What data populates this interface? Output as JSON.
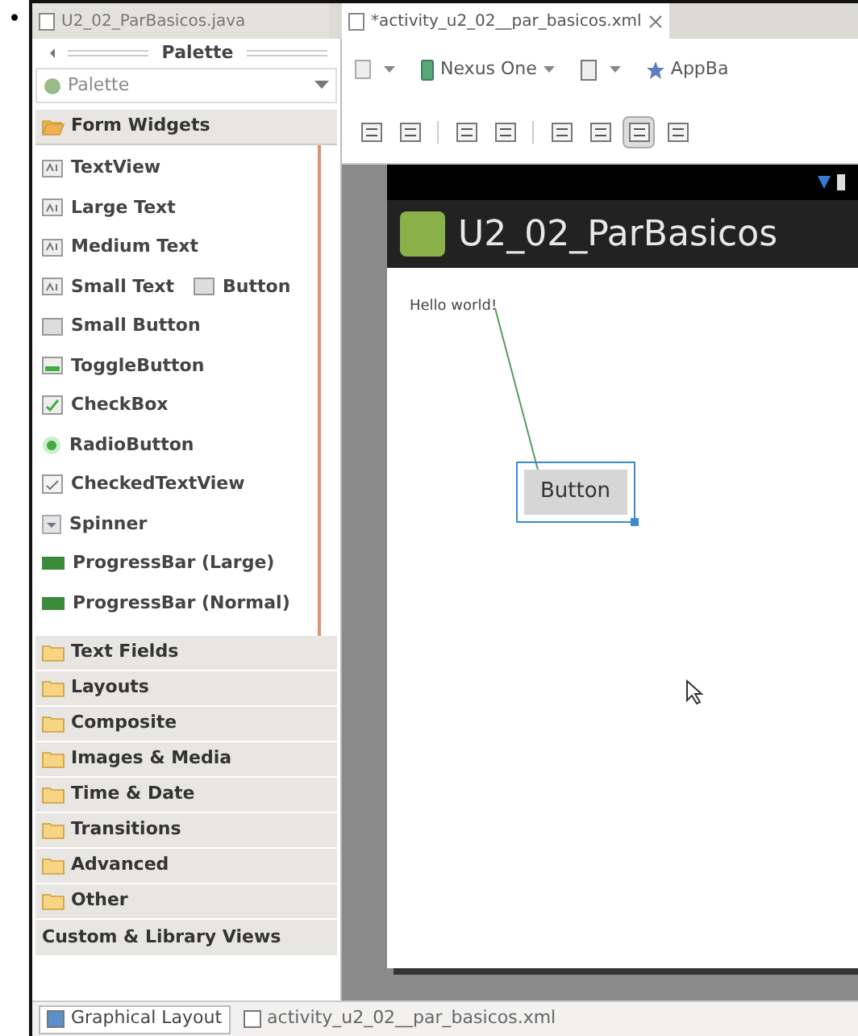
{
  "bullet": "•",
  "editor_tabs": [
    {
      "label": "U2_02_ParBasicos.java",
      "selected": false
    },
    {
      "label": "*activity_u2_02__par_basicos.xml",
      "selected": true
    }
  ],
  "palette": {
    "title": "Palette",
    "dropdown": "Palette",
    "groups": [
      {
        "label": "Form Widgets",
        "expanded": true,
        "rows": [
          {
            "cells": [
              {
                "label": "TextView",
                "kind": "text"
              }
            ]
          },
          {
            "cells": [
              {
                "label": "Large Text",
                "kind": "text"
              }
            ]
          },
          {
            "cells": [
              {
                "label": "Medium Text",
                "kind": "text"
              }
            ]
          },
          {
            "cells": [
              {
                "label": "Small Text",
                "kind": "text"
              },
              {
                "label": "Button",
                "kind": "button"
              }
            ]
          },
          {
            "cells": [
              {
                "label": "Small Button",
                "kind": "button"
              }
            ]
          },
          {
            "cells": [
              {
                "label": "ToggleButton",
                "kind": "toggle"
              }
            ]
          },
          {
            "cells": [
              {
                "label": "CheckBox",
                "kind": "checkbox"
              }
            ]
          },
          {
            "cells": [
              {
                "label": "RadioButton",
                "kind": "radio"
              }
            ]
          },
          {
            "cells": [
              {
                "label": "CheckedTextView",
                "kind": "checked"
              }
            ]
          },
          {
            "cells": [
              {
                "label": "Spinner",
                "kind": "spinner"
              }
            ]
          },
          {
            "cells": [
              {
                "label": "ProgressBar (Large)",
                "kind": "progress"
              }
            ]
          },
          {
            "cells": [
              {
                "label": "ProgressBar (Normal)",
                "kind": "progress"
              }
            ]
          }
        ]
      },
      {
        "label": "Text Fields",
        "expanded": false
      },
      {
        "label": "Layouts",
        "expanded": false
      },
      {
        "label": "Composite",
        "expanded": false
      },
      {
        "label": "Images & Media",
        "expanded": false
      },
      {
        "label": "Time & Date",
        "expanded": false
      },
      {
        "label": "Transitions",
        "expanded": false
      },
      {
        "label": "Advanced",
        "expanded": false
      },
      {
        "label": "Other",
        "expanded": false
      }
    ],
    "custom": "Custom & Library Views"
  },
  "toolbar": {
    "device": "Nexus One",
    "theme": "AppBa",
    "layout_tools": [
      {
        "selected": false
      },
      {
        "selected": false
      },
      {
        "selected": false
      },
      {
        "selected": false
      },
      {
        "selected": false
      },
      {
        "selected": false
      },
      {
        "selected": true
      },
      {
        "selected": false
      }
    ]
  },
  "phone": {
    "app_title": "U2_02_ParBasicos",
    "hello": "Hello world!",
    "button": {
      "label": "Button",
      "selected": true
    }
  },
  "bottom_tabs": [
    {
      "label": "Graphical Layout",
      "selected": true
    },
    {
      "label": "activity_u2_02__par_basicos.xml",
      "selected": false
    }
  ]
}
